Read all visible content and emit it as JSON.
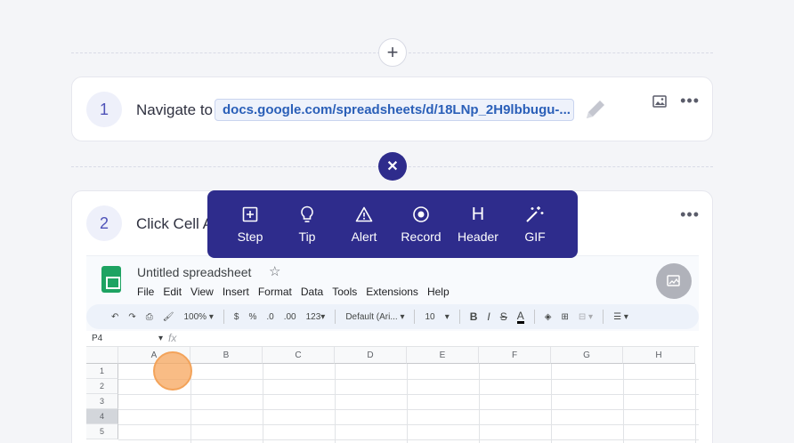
{
  "steps": [
    {
      "number": "1",
      "text": "Navigate to",
      "url": "docs.google.com/spreadsheets/d/18LNp_2H9lbbugu-..."
    },
    {
      "number": "2",
      "text": "Click Cell A"
    }
  ],
  "icons": {
    "add": "plus-icon",
    "close": "close-icon",
    "image": "image-icon",
    "more": "more-icon",
    "edit": "pencil-icon",
    "external": "external-link-icon"
  },
  "popup_menu": [
    {
      "label": "Step",
      "icon": "plus-square-icon"
    },
    {
      "label": "Tip",
      "icon": "lightbulb-icon"
    },
    {
      "label": "Alert",
      "icon": "alert-icon"
    },
    {
      "label": "Record",
      "icon": "record-icon"
    },
    {
      "label": "Header",
      "icon": "header-icon"
    },
    {
      "label": "GIF",
      "icon": "magic-wand-icon"
    }
  ],
  "spreadsheet": {
    "title": "Untitled spreadsheet",
    "menu": [
      "File",
      "Edit",
      "View",
      "Insert",
      "Format",
      "Data",
      "Tools",
      "Extensions",
      "Help"
    ],
    "toolbar": {
      "zoom": "100%",
      "currency": "$",
      "percent": "%",
      "dec_decrease": ".0",
      "dec_increase": ".00",
      "number_format": "123",
      "font": "Default (Ari...",
      "font_size": "10",
      "bold": "B",
      "italic": "I",
      "strike": "S",
      "text_color": "A"
    },
    "name_box": "P4",
    "fx": "fx",
    "columns": [
      "A",
      "B",
      "C",
      "D",
      "E",
      "F",
      "G",
      "H"
    ],
    "rows": [
      "1",
      "2",
      "3",
      "4",
      "5"
    ],
    "selected_row": "4"
  },
  "colors": {
    "accent": "#2e2c8c",
    "link": "#2a5fb8",
    "click_marker": "#f7a65c"
  }
}
